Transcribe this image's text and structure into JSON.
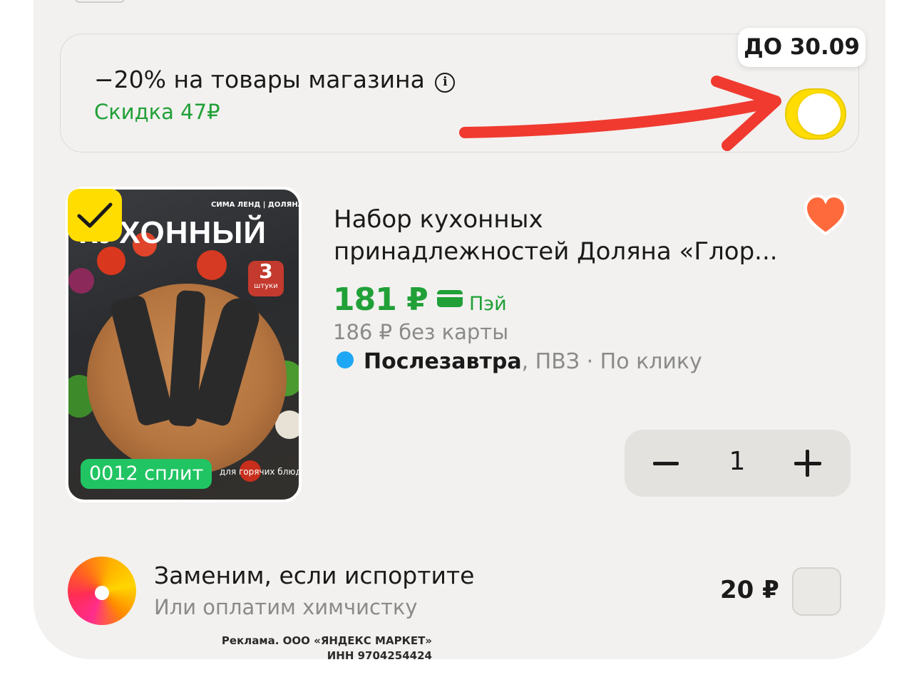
{
  "promo": {
    "title": "−20% на товары магазина",
    "discount": "Скидка 47₽",
    "valid_until": "ДО 30.09",
    "toggle_state": "on"
  },
  "product": {
    "title_line1": "Набор кухонных",
    "title_line2": "принадлежностей Доляна «Глор...",
    "price": "181 ₽",
    "pay_label": "Пэй",
    "old_price": "186 ₽  без карты",
    "delivery_day": "Послезавтра",
    "delivery_rest": ", ПВЗ · По клику",
    "quantity": "1",
    "selected": true,
    "favorite": true,
    "image": {
      "headline": "КУХОННЫЙ",
      "brand": "СИМА ЛЕНД | ДОЛЯНА",
      "count_number": "3",
      "count_label": "штуки",
      "hot_label": "для горячих блюд",
      "split_label": "0012 сплит"
    }
  },
  "insurance": {
    "title": "Заменим, если испортите",
    "subtitle": "Или оплатим химчистку",
    "price": "20 ₽",
    "selected": false
  },
  "ad_disclaimer": {
    "line1": "Реклама. ООО «ЯНДЕКС МАРКЕТ»",
    "line2": "ИНН 9704254424"
  },
  "colors": {
    "accent_green": "#21a038",
    "toggle_yellow": "#ffdd00",
    "heart": "#ff6a3d",
    "delivery_dot": "#1ea7f5",
    "annotation_arrow": "#f03a30"
  }
}
